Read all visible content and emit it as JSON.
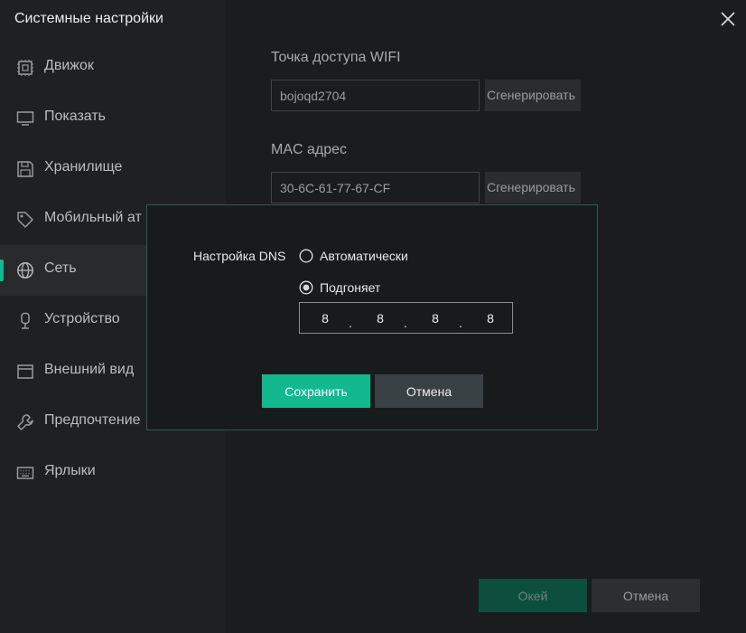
{
  "window": {
    "title": "Системные настройки"
  },
  "sidebar": {
    "items": [
      {
        "label": "Движок",
        "icon": "chip-icon"
      },
      {
        "label": "Показать",
        "icon": "monitor-icon"
      },
      {
        "label": "Хранилище",
        "icon": "save-icon"
      },
      {
        "label": "Мобильный ат",
        "icon": "tag-icon"
      },
      {
        "label": "Сеть",
        "icon": "globe-icon",
        "active": true
      },
      {
        "label": "Устройство",
        "icon": "device-icon"
      },
      {
        "label": "Внешний вид",
        "icon": "window-icon"
      },
      {
        "label": "Предпочтение",
        "icon": "wrench-icon"
      },
      {
        "label": "Ярлыки",
        "icon": "keyboard-icon"
      }
    ]
  },
  "main": {
    "wifi": {
      "label": "Точка доступа WIFI",
      "value": "bojoqd2704",
      "generate_label": "Сгенерировать"
    },
    "mac": {
      "label": "MAC адрес",
      "value": "30-6C-61-77-67-CF",
      "generate_label": "Сгенерировать"
    },
    "ok_label": "Окей",
    "cancel_label": "Отмена"
  },
  "dialog": {
    "dns_label": "Настройка DNS",
    "auto_label": "Автоматически",
    "custom_label": "Подгоняет",
    "selected": "custom",
    "ip": [
      "8",
      "8",
      "8",
      "8"
    ],
    "save_label": "Сохранить",
    "cancel_label": "Отмена"
  },
  "colors": {
    "accent": "#12b98f",
    "background": "#1a1c1d",
    "sidebar": "#1e2021"
  }
}
